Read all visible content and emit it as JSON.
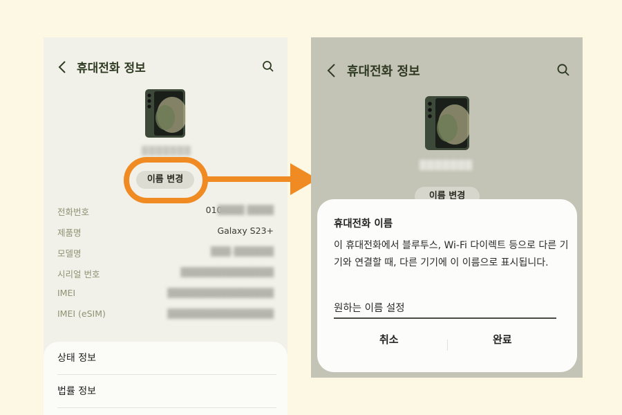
{
  "left": {
    "title": "휴대전화 정보",
    "device_name": "███████",
    "rename_button": "이름 변경",
    "info_rows": [
      {
        "label": "전화번호",
        "value": "010-",
        "blurred_value": "████ ████"
      },
      {
        "label": "제품명",
        "value": "Galaxy S23+",
        "blurred_value": ""
      },
      {
        "label": "모델명",
        "value": "",
        "blurred_value": "███-██████"
      },
      {
        "label": "시리얼 번호",
        "value": "",
        "blurred_value": "██████████████"
      },
      {
        "label": "IMEI",
        "value": "",
        "blurred_value": "████████████████"
      },
      {
        "label": "IMEI (eSIM)",
        "value": "",
        "blurred_value": "████████████████"
      }
    ],
    "menu_items": [
      "상태 정보",
      "법률 정보"
    ]
  },
  "right": {
    "title": "휴대전화 정보",
    "device_name": "███████",
    "rename_button": "이름 변경",
    "dialog": {
      "title": "휴대전화 이름",
      "body": "이 휴대전화에서 블루투스, Wi-Fi 다이렉트 등으로 다른 기기와 연결할 때, 다른 기기에 이 이름으로 표시됩니다.",
      "input_value": "원하는 이름 설정",
      "cancel_label": "취소",
      "done_label": "완료"
    }
  },
  "colors": {
    "accent_orange": "#f08a23",
    "background": "#fdf8e4"
  },
  "icons": [
    "back-icon",
    "search-icon",
    "arrow-icon"
  ]
}
